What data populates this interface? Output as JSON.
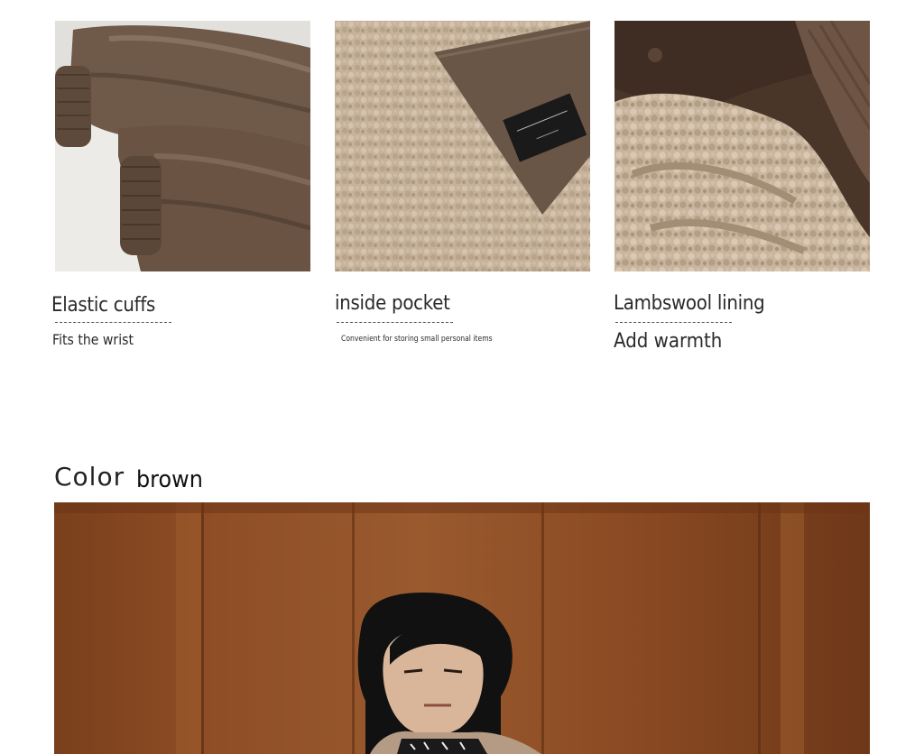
{
  "features": [
    {
      "title": "Elastic cuffs",
      "description": "Fits the wrist",
      "image": "elastic-cuffs-photo"
    },
    {
      "title": "inside pocket",
      "description": "Convenient for storing small personal items",
      "image": "inside-pocket-photo"
    },
    {
      "title": "Lambswool lining",
      "description": "Add warmth",
      "image": "lambswool-lining-photo"
    }
  ],
  "color_section": {
    "label": "Color",
    "value": "brown",
    "image": "model-in-brown-jacket-photo"
  },
  "colors": {
    "fabric_brown": "#6e5644",
    "fleece_beige": "#c7b39d",
    "wood_panel": "#8a4a22"
  }
}
